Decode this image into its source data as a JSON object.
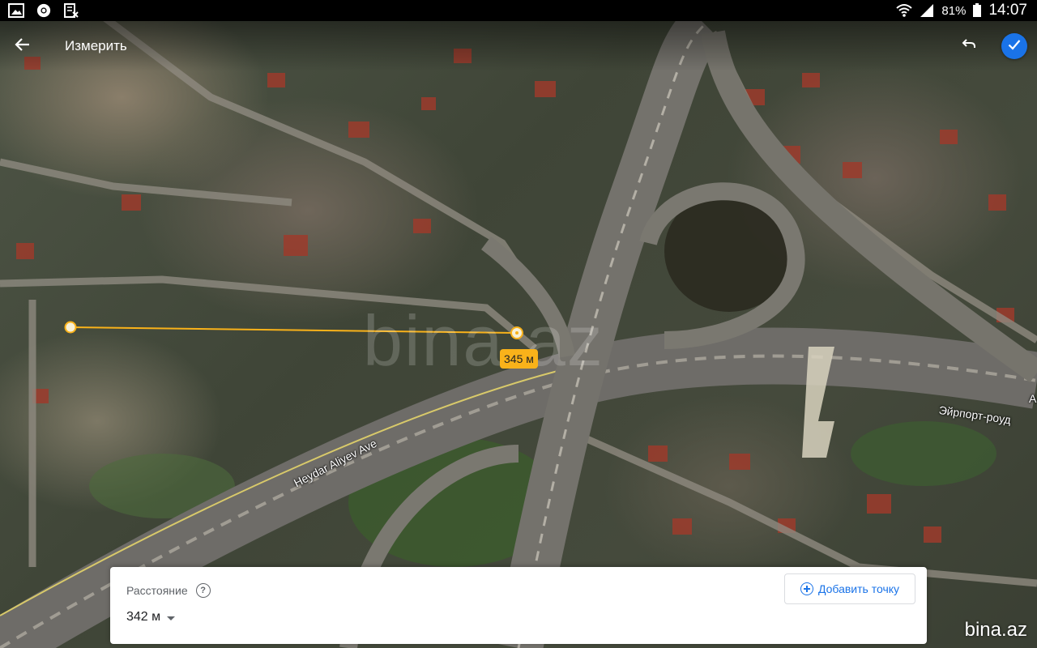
{
  "status_bar": {
    "battery_percent": "81%",
    "time": "14:07",
    "left_icons": [
      "gallery-icon",
      "chrome-icon",
      "file-excel-icon"
    ],
    "right_icons": [
      "wifi-icon",
      "signal-icon",
      "battery-icon"
    ]
  },
  "app_bar": {
    "title": "Измерить",
    "back_icon": "arrow-left-icon",
    "undo_icon": "undo-icon",
    "confirm_icon": "check-icon",
    "confirm_color": "#1a73e8"
  },
  "measurement": {
    "segment_label": "345 м",
    "line_color": "#f9b21a"
  },
  "map_labels": {
    "heydar_aliyev": "Heydar Aliyev Ave",
    "airport_road": "Эйрпорт-роуд",
    "road_a": "A"
  },
  "watermark": {
    "center": "bina.az",
    "corner": "bina.az"
  },
  "bottom_sheet": {
    "label": "Расстояние",
    "help_icon": "help-circle-icon",
    "distance_value": "342 м",
    "add_point_label": "Добавить точку",
    "add_point_icon": "add-circle-icon"
  }
}
